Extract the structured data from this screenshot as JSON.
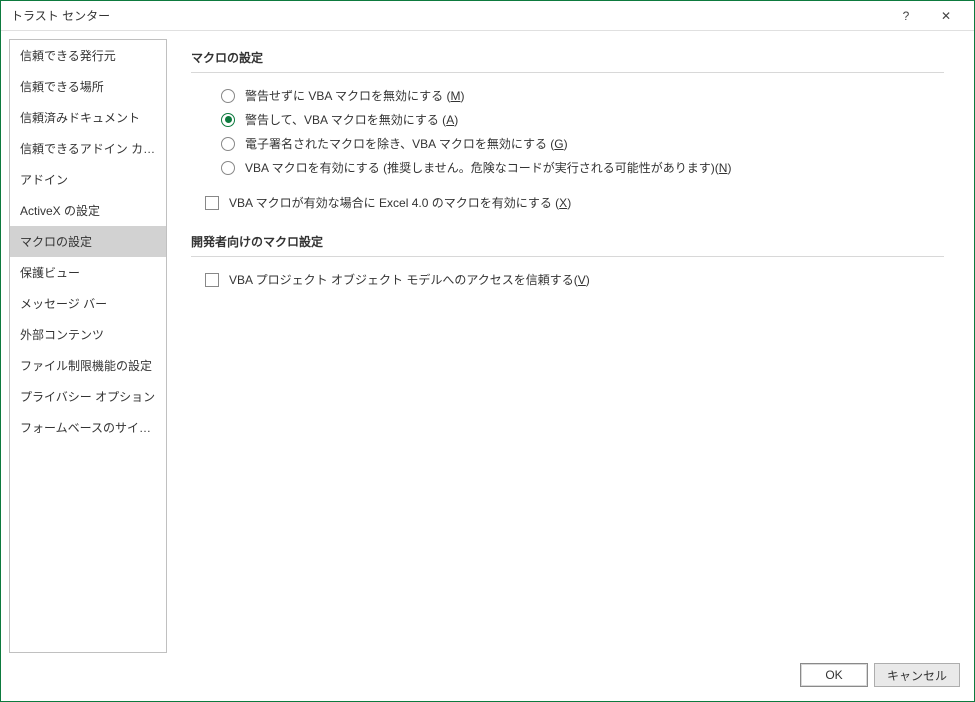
{
  "window": {
    "title": "トラスト センター",
    "help_icon": "?",
    "close_icon": "✕"
  },
  "sidebar": {
    "items": [
      {
        "label": "信頼できる発行元"
      },
      {
        "label": "信頼できる場所"
      },
      {
        "label": "信頼済みドキュメント"
      },
      {
        "label": "信頼できるアドイン カタログ"
      },
      {
        "label": "アドイン"
      },
      {
        "label": "ActiveX の設定"
      },
      {
        "label": "マクロの設定",
        "selected": true
      },
      {
        "label": "保護ビュー"
      },
      {
        "label": "メッセージ バー"
      },
      {
        "label": "外部コンテンツ"
      },
      {
        "label": "ファイル制限機能の設定"
      },
      {
        "label": "プライバシー オプション"
      },
      {
        "label": "フォームベースのサインイン"
      }
    ]
  },
  "content": {
    "section1_title": "マクロの設定",
    "options": [
      {
        "pre": "警告せずに VBA マクロを無効にする (",
        "accel": "M",
        "post": ")",
        "checked": false
      },
      {
        "pre": "警告して、VBA マクロを無効にする (",
        "accel": "A",
        "post": ")",
        "checked": true
      },
      {
        "pre": "電子署名されたマクロを除き、VBA マクロを無効にする (",
        "accel": "G",
        "post": ")",
        "checked": false
      },
      {
        "pre": "VBA マクロを有効にする (推奨しません。危険なコードが実行される可能性があります)(",
        "accel": "N",
        "post": ")",
        "checked": false
      }
    ],
    "check1": {
      "pre": "VBA マクロが有効な場合に Excel 4.0 のマクロを有効にする (",
      "accel": "X",
      "post": ")"
    },
    "section2_title": "開発者向けのマクロ設定",
    "check2": {
      "pre": "VBA プロジェクト オブジェクト モデルへのアクセスを信頼する(",
      "accel": "V",
      "post": ")"
    }
  },
  "footer": {
    "ok": "OK",
    "cancel": "キャンセル"
  }
}
